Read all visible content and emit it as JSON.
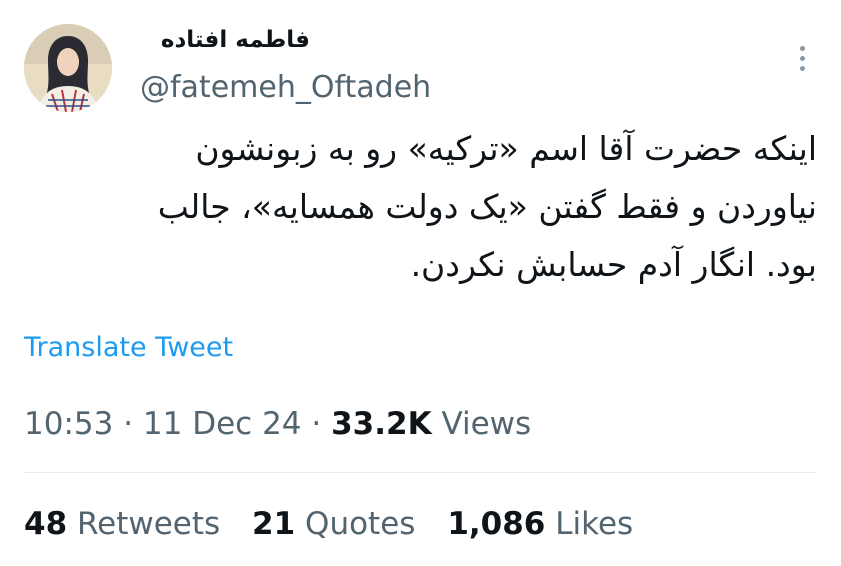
{
  "tweet": {
    "display_name": "فاطمه افتاده",
    "handle": "@fatemeh_Oftadeh",
    "text_lines": [
      "اینکه حضرت آقا اسم «ترکیه» رو به زبونشون",
      "نیاوردن و فقط گفتن «یک دولت همسایه»، جالب",
      "بود. انگار آدم حسابش نکردن."
    ],
    "translate_label": "Translate Tweet",
    "time": "10:53",
    "separator": "·",
    "date": "11 Dec 24",
    "views_count": "33.2K",
    "views_label": "Views"
  },
  "stats": {
    "retweets_count": "48",
    "retweets_label": "Retweets",
    "quotes_count": "21",
    "quotes_label": "Quotes",
    "likes_count": "1,086",
    "likes_label": "Likes"
  },
  "icons": {
    "more": "vertical-dots-icon",
    "avatar": "profile-photo"
  },
  "colors": {
    "link": "#1d9bf0",
    "secondary_text": "#536471",
    "primary_text": "#0f1419",
    "divider": "#e6ecf0"
  }
}
